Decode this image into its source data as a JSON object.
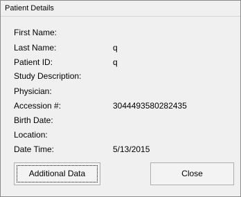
{
  "window": {
    "title": "Patient Details"
  },
  "fields": [
    {
      "label": "First Name:",
      "value": ""
    },
    {
      "label": "Last Name:",
      "value": "q"
    },
    {
      "label": "Patient ID:",
      "value": "q"
    },
    {
      "label": "Study Description:",
      "value": ""
    },
    {
      "label": "Physician:",
      "value": ""
    },
    {
      "label": "Accession #:",
      "value": "3044493580282435"
    },
    {
      "label": "Birth Date:",
      "value": ""
    },
    {
      "label": "Location:",
      "value": ""
    },
    {
      "label": "Date Time:",
      "value": "5/13/2015"
    }
  ],
  "buttons": {
    "additional_label": "Additional Data",
    "close_label": "Close"
  }
}
